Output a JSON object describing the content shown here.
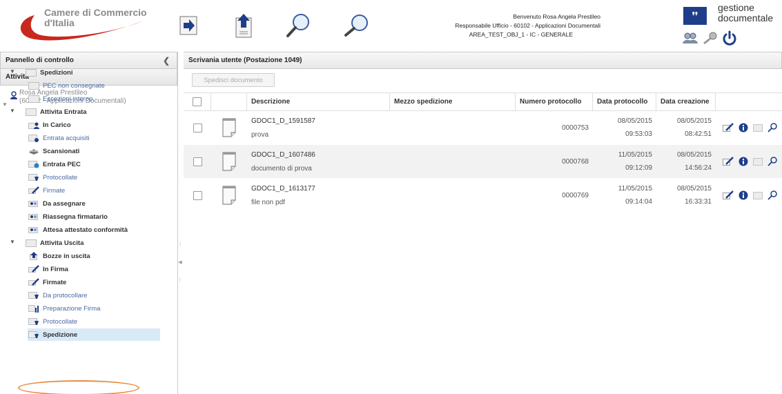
{
  "header": {
    "logo_line1": "Camere di Commercio",
    "logo_line2": "d'Italia",
    "welcome": "Benvenuto Rosa Angela Prestileo",
    "role": "Responsabile Ufficio - 60102 - Applicazioni Documentali",
    "area": "AREA_TEST_OBJ_1 - IC - GENERALE",
    "brand_mark": "❜❜",
    "brand_line1": "gestione",
    "brand_line2": "documentale",
    "colors": {
      "logo_red": "#c8281e",
      "brand_blue": "#1f3e8a"
    }
  },
  "left": {
    "panel_title": "Pannello di controllo",
    "activities_title": "Attività",
    "user_name": "Rosa Angela Prestileo",
    "user_role": "(60102 - Applicazioni Documentali)",
    "tree": [
      {
        "label": "Spedizioni",
        "kind": "folder",
        "icon": "folder-icon"
      },
      {
        "label": "PEC non consegnate",
        "kind": "link",
        "icon": "folder-icon"
      },
      {
        "label": "Eccezioni interop.",
        "kind": "link",
        "icon": "folder-icon"
      },
      {
        "label": "Attivita Entrata",
        "kind": "folder",
        "icon": "folder-icon"
      },
      {
        "label": "In Carico",
        "kind": "bold",
        "icon": "user-folder-icon"
      },
      {
        "label": "Entrata acquisiti",
        "kind": "link",
        "icon": "incoming-icon"
      },
      {
        "label": "Scansionati",
        "kind": "bold",
        "icon": "scanner-icon"
      },
      {
        "label": "Entrata PEC",
        "kind": "bold",
        "icon": "pec-icon"
      },
      {
        "label": "Protocollate",
        "kind": "link",
        "icon": "stamp-icon"
      },
      {
        "label": "Firmate",
        "kind": "link",
        "icon": "pen-icon"
      },
      {
        "label": "Da assegnare",
        "kind": "bold",
        "icon": "assign-icon"
      },
      {
        "label": "Riassegna firmatario",
        "kind": "bold",
        "icon": "assign-icon"
      },
      {
        "label": "Attesa attestato conformità",
        "kind": "bold",
        "icon": "assign-icon"
      },
      {
        "label": "Attivita Uscita",
        "kind": "folder",
        "icon": "folder-icon"
      },
      {
        "label": "Bozze in uscita",
        "kind": "bold",
        "icon": "draft-icon"
      },
      {
        "label": "In Firma",
        "kind": "bold",
        "icon": "pen-icon"
      },
      {
        "label": "Firmate",
        "kind": "bold",
        "icon": "pen-icon"
      },
      {
        "label": "Da protocollare",
        "kind": "link",
        "icon": "stamp-icon"
      },
      {
        "label": "Preparazione Firma",
        "kind": "link",
        "icon": "chart-icon"
      },
      {
        "label": "Protocollate",
        "kind": "link",
        "icon": "stamp-icon"
      },
      {
        "label": "Spedizione",
        "kind": "bold",
        "icon": "stamp-icon"
      }
    ]
  },
  "main": {
    "title": "Scrivania utente (Postazione 1049)",
    "send_button": "Spedisci documento",
    "columns": {
      "desc": "Descrizione",
      "mezzo": "Mezzo spedizione",
      "num": "Numero protocollo",
      "dp": "Data protocollo",
      "dc": "Data creazione"
    },
    "rows": [
      {
        "code": "GDOC1_D_1591587",
        "desc": "prova",
        "mezzo": "",
        "num": "0000753",
        "dp_date": "08/05/2015",
        "dp_time": "09:53:03",
        "dc_date": "08/05/2015",
        "dc_time": "08:42:51"
      },
      {
        "code": "GDOC1_D_1607486",
        "desc": "documento di prova",
        "mezzo": "",
        "num": "0000768",
        "dp_date": "11/05/2015",
        "dp_time": "09:12:09",
        "dc_date": "08/05/2015",
        "dc_time": "14:56:24"
      },
      {
        "code": "GDOC1_D_1613177",
        "desc": "file non pdf",
        "mezzo": "",
        "num": "0000769",
        "dp_date": "11/05/2015",
        "dp_time": "09:14:04",
        "dc_date": "08/05/2015",
        "dc_time": "16:33:31"
      }
    ]
  }
}
